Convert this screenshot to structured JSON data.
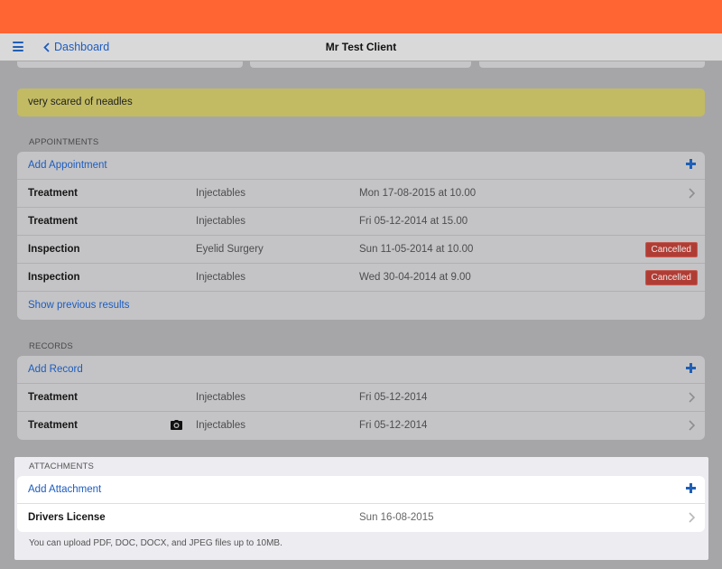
{
  "nav": {
    "back_label": "Dashboard",
    "title": "Mr Test Client"
  },
  "note": "very scared of neadles",
  "appointments": {
    "label": "APPOINTMENTS",
    "add_label": "Add Appointment",
    "rows": [
      {
        "type": "Treatment",
        "category": "Injectables",
        "date": "Mon 17-08-2015 at 10.00",
        "status": ""
      },
      {
        "type": "Treatment",
        "category": "Injectables",
        "date": "Fri 05-12-2014 at 15.00",
        "status": ""
      },
      {
        "type": "Inspection",
        "category": "Eyelid Surgery",
        "date": "Sun 11-05-2014 at 10.00",
        "status": "Cancelled"
      },
      {
        "type": "Inspection",
        "category": "Injectables",
        "date": "Wed 30-04-2014 at 9.00",
        "status": "Cancelled"
      }
    ],
    "show_previous": "Show previous results"
  },
  "records": {
    "label": "RECORDS",
    "add_label": "Add Record",
    "rows": [
      {
        "type": "Treatment",
        "category": "Injectables",
        "date": "Fri 05-12-2014",
        "icon": ""
      },
      {
        "type": "Treatment",
        "category": "Injectables",
        "date": "Fri 05-12-2014",
        "icon": "camera-icon"
      }
    ]
  },
  "attachments": {
    "label": "ATTACHMENTS",
    "add_label": "Add Attachment",
    "rows": [
      {
        "name": "Drivers License",
        "date": "Sun 16-08-2015"
      }
    ],
    "hint": "You can upload PDF, DOC, DOCX, and JPEG files up to 10MB."
  },
  "colors": {
    "brand": "#ff6533",
    "link": "#1c5cc0",
    "note_bg": "#c2bb63",
    "cancelled_badge": "#b03d35",
    "overlay": "#a6a6a9"
  }
}
